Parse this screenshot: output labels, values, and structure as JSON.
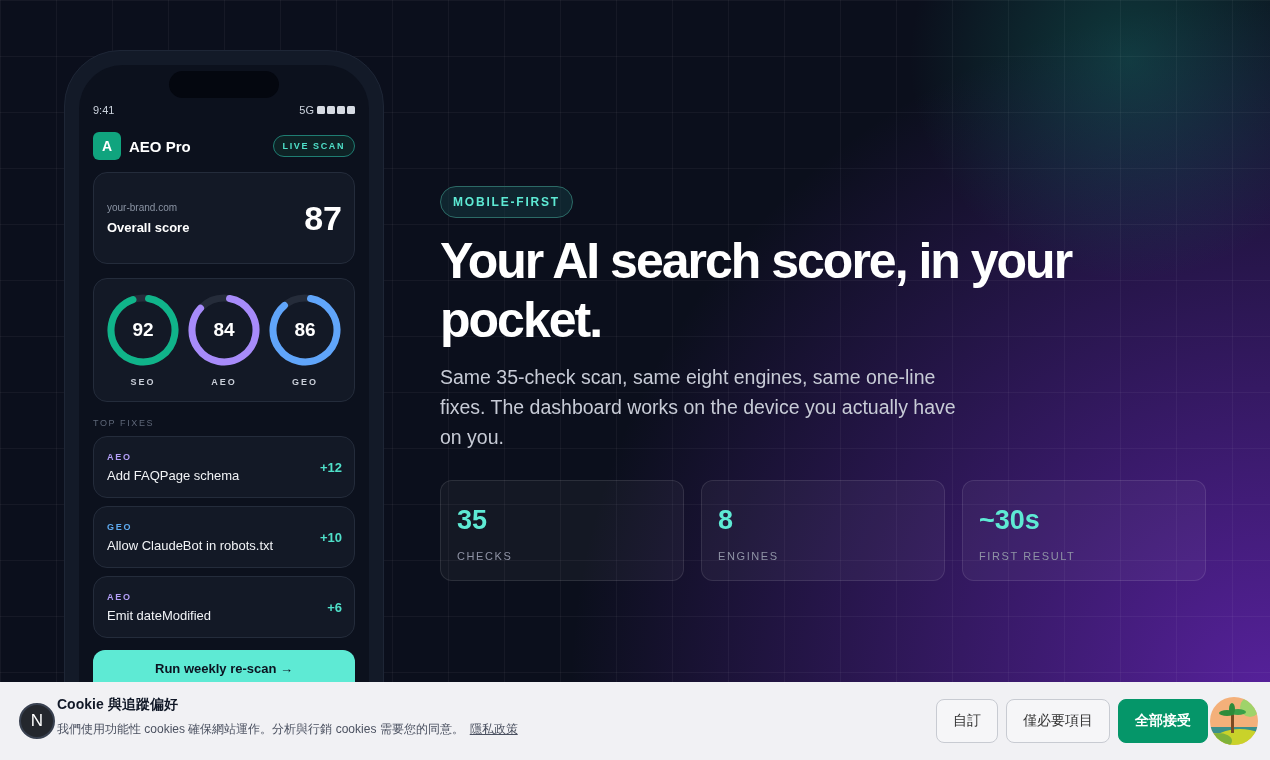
{
  "phone": {
    "status_bar": {
      "time": "9:41",
      "network": "5G"
    },
    "app": {
      "logo_letter": "A",
      "name": "AEO Pro",
      "badge": "LIVE SCAN"
    },
    "score_card": {
      "domain": "your-brand.com",
      "label": "Overall score",
      "score": "87"
    },
    "gauges": [
      {
        "value": "92",
        "label": "SEO",
        "level": 0.92,
        "color": "#10b48a"
      },
      {
        "value": "84",
        "label": "AEO",
        "level": 0.84,
        "color": "#a78bfa"
      },
      {
        "value": "86",
        "label": "GEO",
        "level": 0.86,
        "color": "#60a5fa"
      }
    ],
    "fixes_heading": "TOP FIXES",
    "fixes": [
      {
        "tag": "AEO",
        "color": "#b4a0f8",
        "title": "Add FAQPage schema",
        "gain": "+12"
      },
      {
        "tag": "GEO",
        "color": "#5eaaf0",
        "title": "Allow ClaudeBot in robots.txt",
        "gain": "+10"
      },
      {
        "tag": "AEO",
        "color": "#b4a0f8",
        "title": "Emit dateModified",
        "gain": "+6"
      }
    ],
    "cta": "Run weekly re-scan →"
  },
  "hero": {
    "badge": "MOBILE-FIRST",
    "title": "Your AI search score, in your pocket.",
    "description": "Same 35-check scan, same eight engines, same one-line fixes. The dashboard works on the device you actually have on you.",
    "stats": [
      {
        "value": "35",
        "label": "CHECKS"
      },
      {
        "value": "8",
        "label": "ENGINES"
      },
      {
        "value": "~30s",
        "label": "FIRST RESULT"
      }
    ]
  },
  "cookie_banner": {
    "logo_letter": "N",
    "title": "Cookie 與追蹤偏好",
    "message": "我們使用功能性 cookies 確保網站運作。分析與行銷 cookies 需要您的同意。",
    "link": "隱私政策",
    "buttons": [
      {
        "label": "自訂",
        "kind": "outline"
      },
      {
        "label": "僅必要項目",
        "kind": "outline"
      },
      {
        "label": "全部接受",
        "kind": "primary"
      }
    ]
  }
}
